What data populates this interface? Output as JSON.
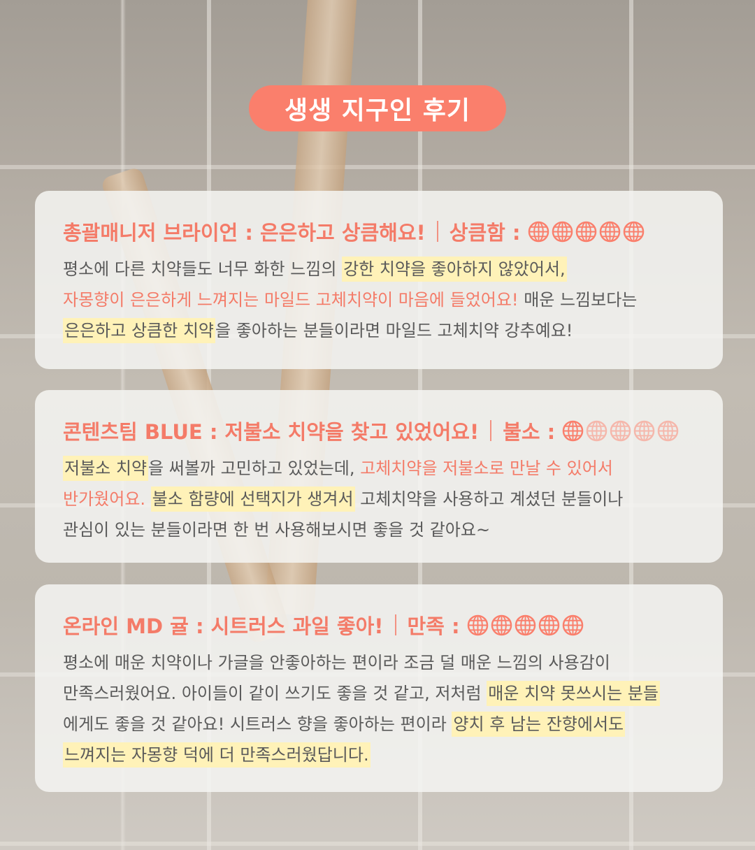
{
  "badge": "생생 지구인 후기",
  "colors": {
    "accent": "#fa7f6c",
    "highlight": "#fff2b8",
    "text": "#5a5a5a"
  },
  "reviews": [
    {
      "reviewer": "총괄매니저 브라이언 : 은은하고 상큼해요!",
      "rating_label": "상큼함 :",
      "rating": 5,
      "rating_max": 5,
      "rating_icon": "globe-icon",
      "lines": [
        [
          {
            "t": "평소에 다른 치약들도 너무 화한 느낌의 ",
            "s": "n"
          },
          {
            "t": "강한 치약을 좋아하지 않았어서,",
            "s": "h"
          }
        ],
        [
          {
            "t": "자몽향이 은은하게 느껴지는 마일드 고체치약이 마음에 들었어요!",
            "s": "r"
          },
          {
            "t": " 매운 느낌보다는",
            "s": "n"
          }
        ],
        [
          {
            "t": "은은하고 상큼한 치약",
            "s": "h"
          },
          {
            "t": "을 좋아하는 분들이라면 마일드 고체치약 강추예요!",
            "s": "n"
          }
        ]
      ]
    },
    {
      "reviewer": "콘텐츠팀 BLUE : 저불소 치약을 찾고 있었어요!",
      "rating_label": "불소 :",
      "rating": 1,
      "rating_max": 5,
      "rating_icon": "globe-icon",
      "lines": [
        [
          {
            "t": "저불소 치약",
            "s": "h"
          },
          {
            "t": "을 써볼까 고민하고 있었는데, ",
            "s": "n"
          },
          {
            "t": "고체치약을 저불소로 만날 수 있어서",
            "s": "r"
          }
        ],
        [
          {
            "t": "반가웠어요.",
            "s": "r"
          },
          {
            "t": " ",
            "s": "n"
          },
          {
            "t": "불소 함량에 선택지가 생겨서",
            "s": "h"
          },
          {
            "t": " 고체치약을 사용하고 계셨던 분들이나",
            "s": "n"
          }
        ],
        [
          {
            "t": "관심이 있는 분들이라면 한 번 사용해보시면 좋을 것 같아요~",
            "s": "n"
          }
        ]
      ]
    },
    {
      "reviewer": "온라인 MD 귤 : 시트러스 과일 좋아!",
      "rating_label": "만족 :",
      "rating": 5,
      "rating_max": 5,
      "rating_icon": "globe-icon",
      "lines": [
        [
          {
            "t": "평소에 매운 치약이나 가글을 안좋아하는 편이라 조금 덜 매운 느낌의 사용감이",
            "s": "n"
          }
        ],
        [
          {
            "t": "만족스러웠어요. 아이들이 같이 쓰기도 좋을 것 같고, 저처럼 ",
            "s": "n"
          },
          {
            "t": "매운 치약 못쓰시는 분들",
            "s": "h"
          }
        ],
        [
          {
            "t": "에게도 좋을 것 같아요! 시트러스 향을 좋아하는 편이라 ",
            "s": "n"
          },
          {
            "t": "양치 후 남는 잔향에서도",
            "s": "h"
          }
        ],
        [
          {
            "t": "느껴지는 자몽향 덕에 더 만족스러웠답니다.",
            "s": "h"
          }
        ]
      ]
    }
  ]
}
